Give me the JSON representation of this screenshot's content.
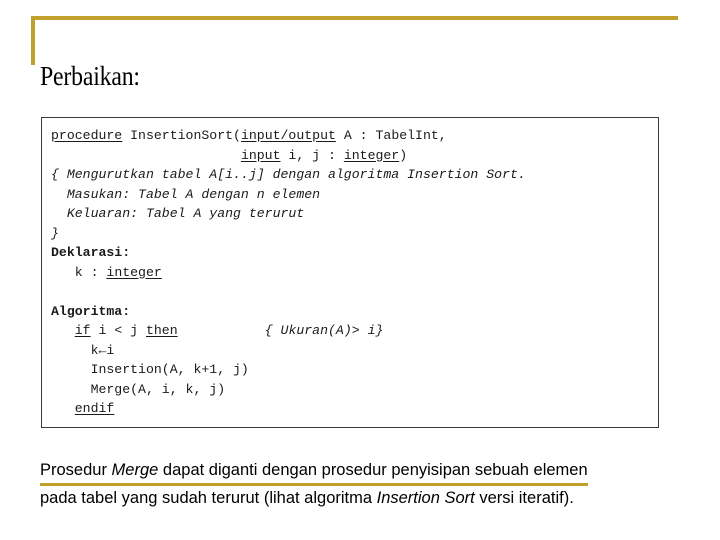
{
  "slide": {
    "title": "Perbaikan:",
    "accent_color": "#C2A02C",
    "text_color": "#000000",
    "background_color": "#FFFFFF"
  },
  "code_block": {
    "border_color": "#3B3B3B",
    "lines": [
      {
        "id": "line-1",
        "segments": [
          {
            "kind": "keyword",
            "text": "procedure"
          },
          {
            "kind": "plain",
            "text": " InsertionSort("
          },
          {
            "kind": "keyword",
            "text": "input/output"
          },
          {
            "kind": "plain",
            "text": " A : TabelInt,"
          }
        ]
      },
      {
        "id": "line-2",
        "segments": [
          {
            "kind": "plain",
            "text": "                        "
          },
          {
            "kind": "keyword",
            "text": "input"
          },
          {
            "kind": "plain",
            "text": " i, j : "
          },
          {
            "kind": "keyword",
            "text": "integer"
          },
          {
            "kind": "plain",
            "text": ")"
          }
        ]
      },
      {
        "id": "line-3",
        "segments": [
          {
            "kind": "comment",
            "text": "{ Mengurutkan tabel A[i..j] dengan algoritma Insertion Sort."
          }
        ]
      },
      {
        "id": "line-4",
        "segments": [
          {
            "kind": "comment",
            "text": "  Masukan: Tabel A dengan n elemen"
          }
        ]
      },
      {
        "id": "line-5",
        "segments": [
          {
            "kind": "comment",
            "text": "  Keluaran: Tabel A yang terurut"
          }
        ]
      },
      {
        "id": "line-6",
        "segments": [
          {
            "kind": "comment",
            "text": "}"
          }
        ]
      },
      {
        "id": "line-7",
        "segments": [
          {
            "kind": "bold",
            "text": "Deklarasi:"
          }
        ]
      },
      {
        "id": "line-8",
        "segments": [
          {
            "kind": "plain",
            "text": "   k : "
          },
          {
            "kind": "keyword",
            "text": "integer"
          }
        ]
      },
      {
        "id": "line-9",
        "segments": [
          {
            "kind": "plain",
            "text": ""
          }
        ]
      },
      {
        "id": "line-10",
        "segments": [
          {
            "kind": "bold",
            "text": "Algoritma:"
          }
        ]
      },
      {
        "id": "line-11",
        "segments": [
          {
            "kind": "plain",
            "text": "   "
          },
          {
            "kind": "keyword",
            "text": "if"
          },
          {
            "kind": "plain",
            "text": " i < j "
          },
          {
            "kind": "keyword",
            "text": "then"
          },
          {
            "kind": "plain",
            "text": "           "
          },
          {
            "kind": "comment",
            "text": "{ Ukuran(A)> i}"
          }
        ]
      },
      {
        "id": "line-12",
        "segments": [
          {
            "kind": "plain",
            "text": "     k←i"
          }
        ]
      },
      {
        "id": "line-13",
        "segments": [
          {
            "kind": "plain",
            "text": "     Insertion(A, k+1, j)"
          }
        ]
      },
      {
        "id": "line-14",
        "segments": [
          {
            "kind": "plain",
            "text": "     Merge(A, i, k, j)"
          }
        ]
      },
      {
        "id": "line-15",
        "segments": [
          {
            "kind": "plain",
            "text": "   "
          },
          {
            "kind": "keyword",
            "text": "endif"
          }
        ]
      }
    ]
  },
  "caption": {
    "line_1": [
      {
        "kind": "plain",
        "text": "Prosedur "
      },
      {
        "kind": "italic",
        "text": "Merge"
      },
      {
        "kind": "plain",
        "text": " dapat diganti dengan prosedur penyisipan sebuah elemen"
      }
    ],
    "line_2": [
      {
        "kind": "plain",
        "text": "pada tabel yang sudah terurut (lihat algoritma "
      },
      {
        "kind": "italic",
        "text": "Insertion Sort"
      },
      {
        "kind": "plain",
        "text": " versi iteratif)."
      }
    ]
  }
}
